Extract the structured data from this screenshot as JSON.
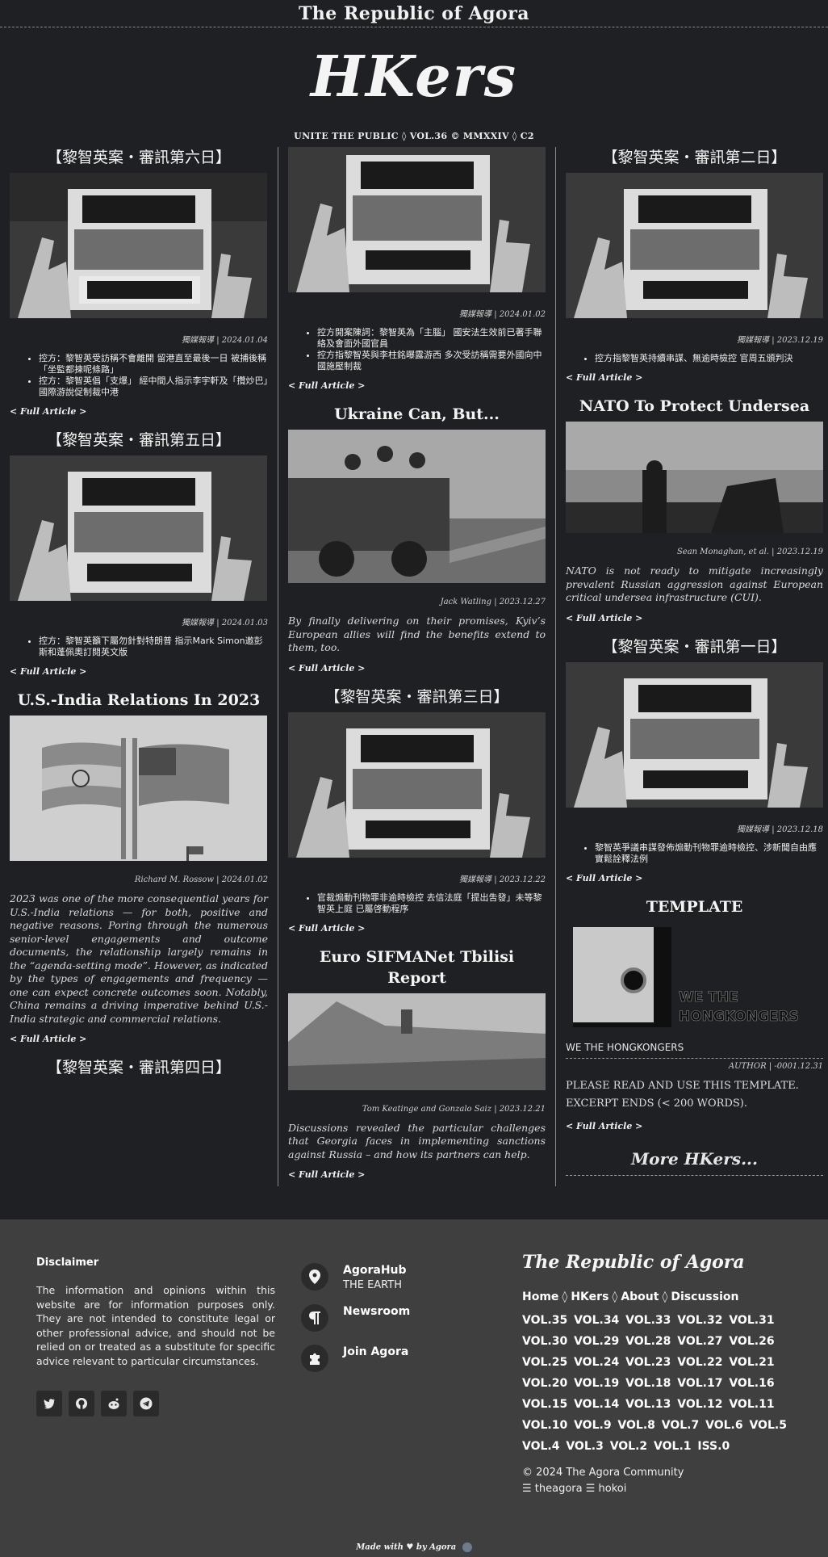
{
  "header": {
    "site_title": "The Republic of Agora",
    "logo": "HKers",
    "tagline": "UNITE THE PUBLIC ◊ VOL.36 © MMXXIV ◊ C2"
  },
  "full_article_label": "< Full Article >",
  "col1": [
    {
      "title": "【黎智英案・審訊第六日】",
      "image": "newspaper-protest-photo",
      "byline": "獨媒報導 | 2024.01.04",
      "bullets": [
        "控方：黎智英受訪稱不會離開 留港直至最後一日 被捕後稱「坐監都揀呢條路」",
        "控方：黎智英倡「支爆」 經中間人指示李宇軒及「攬炒巴」國際游說促制裁中港"
      ]
    },
    {
      "title": "【黎智英案・審訊第五日】",
      "image": "newspaper-protest-photo",
      "byline": "獨媒報導 | 2024.01.03",
      "bullets": [
        "控方：黎智英籲下屬勿針對特朗普 指示Mark Simon邀彭斯和蓬佩奧訂閱英文版"
      ]
    },
    {
      "title": "U.S.-India Relations In 2023",
      "image": "india-us-flags-illustration",
      "byline": "Richard M. Rossow | 2024.01.02",
      "lede": "2023 was one of the more consequential years for U.S.-India relations — for both, positive and negative reasons. Poring through the numerous senior-level engagements and outcome documents, the relationship largely remains in the “agenda-setting mode”. However, as indicated by the types of engagements and frequency — one can expect concrete outcomes soon. Notably, China remains a driving imperative behind U.S.-India strategic and commercial relations."
    },
    {
      "title": "【黎智英案・審訊第四日】"
    }
  ],
  "col2": [
    {
      "image": "newspaper-protest-photo",
      "byline": "獨媒報導 | 2024.01.02",
      "bullets": [
        "控方開案陳詞：黎智英為「主腦」 國安法生效前已著手聯絡及會面外國官員",
        "控方指黎智英與李柱銘曝露游西 多次受訪稱需要外國向中國施壓制裁"
      ]
    },
    {
      "title": "Ukraine Can, But...",
      "image": "soldiers-vehicle-photo",
      "byline": "Jack Watling | 2023.12.27",
      "lede": "By finally delivering on their promises, Kyiv’s European allies will find the benefits extend to them, too."
    },
    {
      "title": "【黎智英案・審訊第三日】",
      "image": "newspaper-protest-photo",
      "byline": "獨媒報導 | 2023.12.22",
      "bullets": [
        "官裁煽動刊物罪非逾時檢控 去信法庭「提出吿發」未等黎智英上庭 已屬啓動程序"
      ]
    },
    {
      "title": "Euro SIFMANet Tbilisi Report",
      "image": "tbilisi-city-photo",
      "byline": "Tom Keatinge and Gonzalo Saiz | 2023.12.21",
      "lede": "Discussions revealed the particular challenges that Georgia faces in implementing sanctions against Russia – and how its partners can help."
    }
  ],
  "col3": [
    {
      "title": "【黎智英案・審訊第二日】",
      "image": "newspaper-protest-photo",
      "byline": "獨媒報導 | 2023.12.19",
      "bullets": [
        "控方指黎智英持續串謀、無逾時檢控 官周五頒判決"
      ]
    },
    {
      "title": "NATO To Protect Undersea",
      "image": "ship-binoculars-photo",
      "byline": "Sean Monaghan, et al. | 2023.12.19",
      "lede": "NATO is not ready to mitigate increasingly prevalent Russian aggression against European critical undersea infrastructure (CUI)."
    },
    {
      "title": "【黎智英案・審訊第一日】",
      "image": "newspaper-protest-photo",
      "byline": "獨媒報導 | 2023.12.18",
      "bullets": [
        "黎智英爭議串謀發佈煽動刊物罪逾時檢控、涉新聞自由應實鬆詮釋法例"
      ]
    },
    {
      "title": "TEMPLATE",
      "image": "we-the-hongkongers-logo",
      "logo_text": "WE THE HONGKONGERS",
      "caption": "WE THE HONGKONGERS",
      "byline": "AUTHOR | -0001.12.31",
      "body": [
        "PLEASE READ AND USE THIS TEMPLATE.",
        "EXCERPT ENDS (< 200 WORDS)."
      ]
    }
  ],
  "more_label": "More HKers...",
  "footer": {
    "disclaimer_title": "Disclaimer",
    "disclaimer_text": "The information and opinions within this website are for information purposes only. They are not intended to constitute legal or other professional advice, and should not be relied on or treated as a substitute for specific advice relevant to particular circumstances.",
    "social_icons": [
      "twitter-icon",
      "github-icon",
      "reddit-icon",
      "telegram-icon"
    ],
    "links": [
      {
        "icon": "location-pin-icon",
        "label": "AgoraHub",
        "sub": "THE EARTH"
      },
      {
        "icon": "pilcrow-icon",
        "label": "Newsroom"
      },
      {
        "icon": "puzzle-icon",
        "label": "Join Agora"
      }
    ],
    "brand": "The Republic of Agora",
    "nav": [
      "Home",
      "HKers",
      "About",
      "Discussion"
    ],
    "nav_sep": "◊",
    "volumes": "VOL.35 VOL.34 VOL.33 VOL.32 VOL.31 VOL.30 VOL.29 VOL.28 VOL.27 VOL.26 VOL.25 VOL.24 VOL.23 VOL.22 VOL.21 VOL.20 VOL.19 VOL.18 VOL.17 VOL.16 VOL.15 VOL.14 VOL.13 VOL.12 VOL.11 VOL.10 VOL.9 VOL.8 VOL.7 VOL.6 VOL.5 VOL.4 VOL.3 VOL.2 VOL.1 ISS.0",
    "copyright": "© 2024 The Agora Community",
    "handles": "☰ theagora ☰ hokoi",
    "made_with": "Made with ♥ by Agora"
  }
}
